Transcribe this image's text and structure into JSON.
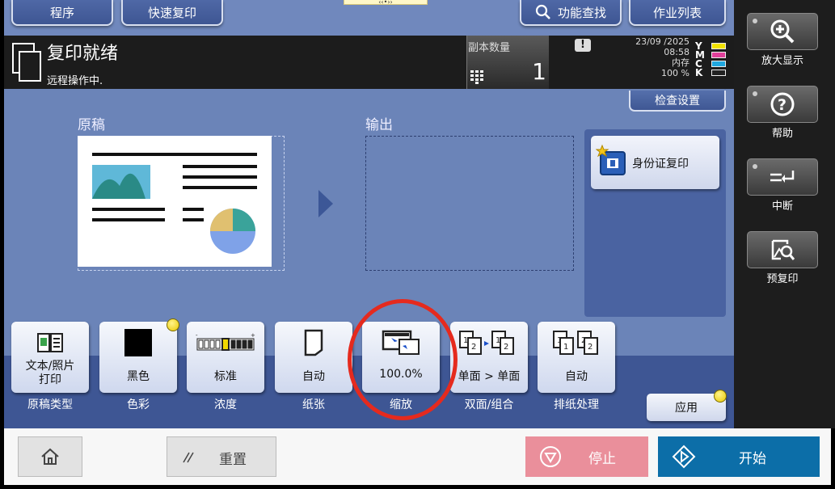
{
  "topbar": {
    "program_label": "程序",
    "quick_copy_label": "快速复印",
    "function_search_label": "功能查找",
    "job_list_label": "作业列表"
  },
  "status": {
    "title": "复印就绪",
    "subtitle": "远程操作中.",
    "copies_label": "副本数量",
    "copies_value": "1",
    "date": "23/09 /2025",
    "time": "08:58",
    "memory_label": "内存",
    "memory_value": "100 %",
    "toner_letters": [
      "Y",
      "M",
      "C",
      "K"
    ],
    "toner_colors": [
      "#f2e200",
      "#e0409a",
      "#20a8e0",
      "#222222"
    ]
  },
  "check_settings_label": "检查设置",
  "original_label": "原稿",
  "output_label": "输出",
  "id_copy_label": "身份证复印",
  "functions": [
    {
      "value": "文本/照片\n打印",
      "label": "原稿类型"
    },
    {
      "value": "黑色",
      "label": "色彩"
    },
    {
      "value": "标准",
      "label": "浓度"
    },
    {
      "value": "自动",
      "label": "纸张"
    },
    {
      "value": "100.0%",
      "label": "缩放"
    },
    {
      "value": "单面 > 单面",
      "label": "双面/组合"
    },
    {
      "value": "自动",
      "label": "排纸处理"
    }
  ],
  "apply_label": "应用",
  "sidebar": {
    "zoom_label": "放大显示",
    "help_label": "帮助",
    "interrupt_label": "中断",
    "preview_label": "预复印"
  },
  "bottom": {
    "reset_label": "重置",
    "stop_label": "停止",
    "start_label": "开始"
  },
  "colors": {
    "accent_blue": "#6b84b8",
    "start_button": "#0c6ea8",
    "stop_button": "#ea8f9b",
    "highlight_circle": "#e52a1e"
  }
}
